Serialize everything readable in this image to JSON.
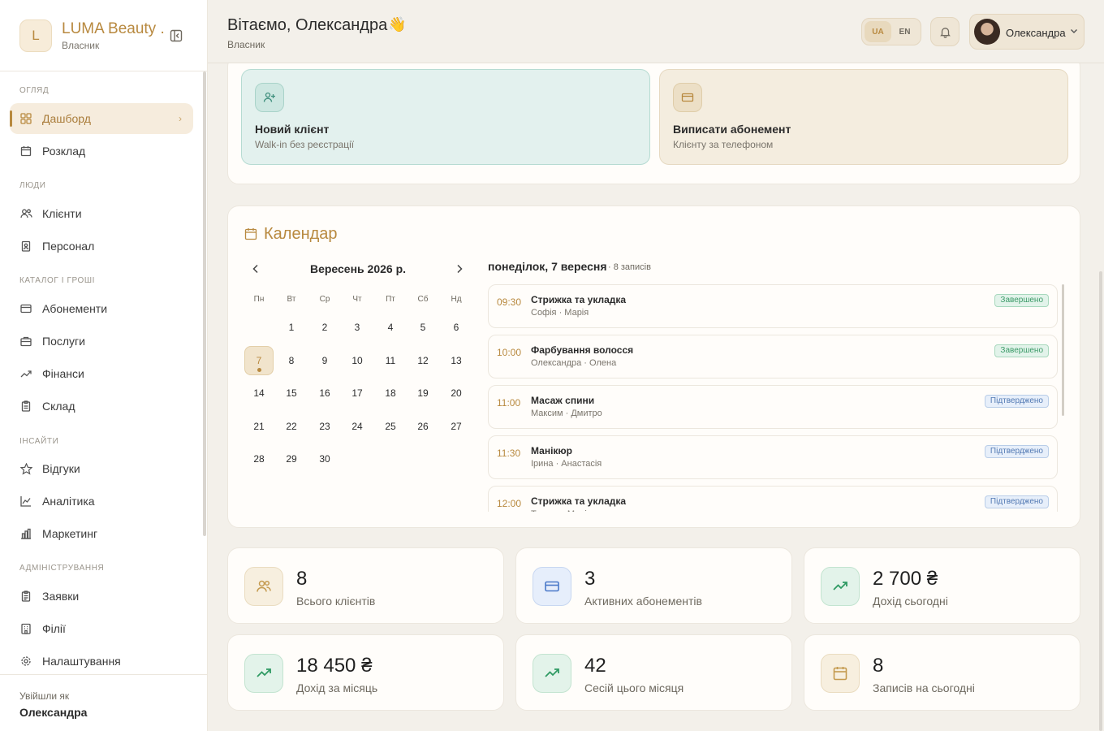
{
  "brand": {
    "initial": "L",
    "name": "LUMA Beauty ...",
    "role": "Власник"
  },
  "nav": {
    "sections": [
      "Огляд",
      "Люди",
      "Каталог і гроші",
      "Інсайти",
      "Адміністрування"
    ],
    "items": [
      {
        "label": "Дашборд",
        "icon": "grid-icon",
        "active": true
      },
      {
        "label": "Розклад",
        "icon": "calendar-icon"
      },
      {
        "label": "Клієнти",
        "icon": "users-icon"
      },
      {
        "label": "Персонал",
        "icon": "badge-icon"
      },
      {
        "label": "Абонементи",
        "icon": "card-icon"
      },
      {
        "label": "Послуги",
        "icon": "briefcase-icon"
      },
      {
        "label": "Фінанси",
        "icon": "trend-icon"
      },
      {
        "label": "Склад",
        "icon": "clipboard-icon"
      },
      {
        "label": "Відгуки",
        "icon": "star-icon"
      },
      {
        "label": "Аналітика",
        "icon": "chart-line-icon"
      },
      {
        "label": "Маркетинг",
        "icon": "bar-chart-icon"
      },
      {
        "label": "Заявки",
        "icon": "clipboard-list-icon"
      },
      {
        "label": "Філії",
        "icon": "building-icon"
      },
      {
        "label": "Налаштування",
        "icon": "gear-icon"
      }
    ]
  },
  "footer": {
    "label": "Увійшли як",
    "name": "Олександра"
  },
  "header": {
    "greeting": "Вітаємо, Олександра",
    "wave": "👋",
    "role": "Власник",
    "lang_ua": "UA",
    "lang_en": "EN",
    "active_lang": "UA",
    "profile_name": "Олександра"
  },
  "quick_actions": [
    {
      "title": "Новий клієнт",
      "subtitle": "Walk-in без реєстрації",
      "icon": "user-plus-icon"
    },
    {
      "title": "Виписати абонемент",
      "subtitle": "Клієнту за телефоном",
      "icon": "card-icon"
    }
  ],
  "calendar": {
    "title": "Календар",
    "month_label": "Вересень 2026 р.",
    "weekdays": [
      "Пн",
      "Вт",
      "Ср",
      "Чт",
      "Пт",
      "Сб",
      "Нд"
    ],
    "selected_day": "7",
    "days": [
      "1",
      "2",
      "3",
      "4",
      "5",
      "6",
      "7",
      "8",
      "9",
      "10",
      "11",
      "12",
      "13",
      "14",
      "15",
      "16",
      "17",
      "18",
      "19",
      "20",
      "21",
      "22",
      "23",
      "24",
      "25",
      "26",
      "27",
      "28",
      "29",
      "30"
    ],
    "day_heading": "понеділок, 7 вересня",
    "day_count": "· 8 записів",
    "appointments": [
      {
        "time": "09:30",
        "service": "Стрижка та укладка",
        "people": "Софія · Марія",
        "status": "Завершено",
        "kind": "done"
      },
      {
        "time": "10:00",
        "service": "Фарбування волосся",
        "people": "Олександра · Олена",
        "status": "Завершено",
        "kind": "done"
      },
      {
        "time": "11:00",
        "service": "Масаж спини",
        "people": "Максим · Дмитро",
        "status": "Підтверджено",
        "kind": "conf"
      },
      {
        "time": "11:30",
        "service": "Манікюр",
        "people": "Ірина · Анастасія",
        "status": "Підтверджено",
        "kind": "conf"
      },
      {
        "time": "12:00",
        "service": "Стрижка та укладка",
        "people": "Тетяна · Марія",
        "status": "Підтверджено",
        "kind": "conf"
      }
    ]
  },
  "stats": [
    {
      "value": "8",
      "label": "Всього клієнтів",
      "icon": "users-icon",
      "tone": "cream"
    },
    {
      "value": "3",
      "label": "Активних абонементів",
      "icon": "card-icon",
      "tone": "blue"
    },
    {
      "value": "2 700 ₴",
      "label": "Дохід сьогодні",
      "icon": "trend-up-icon",
      "tone": "green"
    },
    {
      "value": "18 450 ₴",
      "label": "Дохід за місяць",
      "icon": "trend-up-icon",
      "tone": "green"
    },
    {
      "value": "42",
      "label": "Сесій цього місяця",
      "icon": "trend-up-icon",
      "tone": "green"
    },
    {
      "value": "8",
      "label": "Записів на сьогодні",
      "icon": "calendar-icon",
      "tone": "cream"
    }
  ],
  "colors": {
    "accent": "#b8893f",
    "background": "#f3f0ea",
    "card": "#fffdfa",
    "success": "#3b9a67",
    "info": "#5279b3"
  }
}
